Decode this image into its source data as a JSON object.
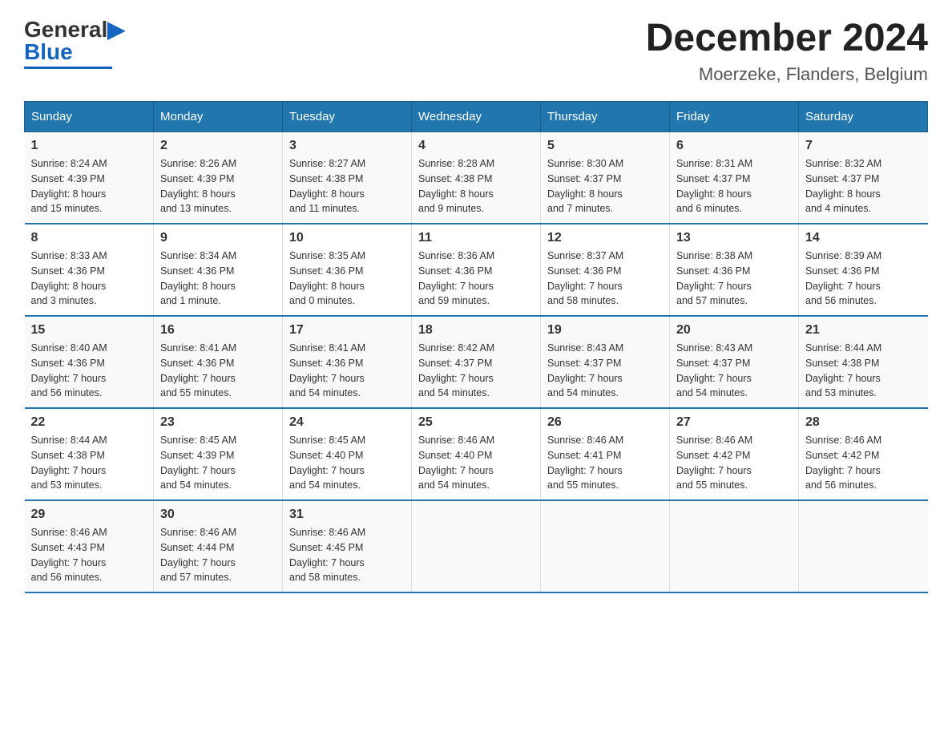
{
  "header": {
    "logo_text_black": "General",
    "logo_text_blue": "Blue",
    "title": "December 2024",
    "subtitle": "Moerzeke, Flanders, Belgium"
  },
  "calendar": {
    "days_of_week": [
      "Sunday",
      "Monday",
      "Tuesday",
      "Wednesday",
      "Thursday",
      "Friday",
      "Saturday"
    ],
    "weeks": [
      [
        {
          "day": "1",
          "info": "Sunrise: 8:24 AM\nSunset: 4:39 PM\nDaylight: 8 hours\nand 15 minutes."
        },
        {
          "day": "2",
          "info": "Sunrise: 8:26 AM\nSunset: 4:39 PM\nDaylight: 8 hours\nand 13 minutes."
        },
        {
          "day": "3",
          "info": "Sunrise: 8:27 AM\nSunset: 4:38 PM\nDaylight: 8 hours\nand 11 minutes."
        },
        {
          "day": "4",
          "info": "Sunrise: 8:28 AM\nSunset: 4:38 PM\nDaylight: 8 hours\nand 9 minutes."
        },
        {
          "day": "5",
          "info": "Sunrise: 8:30 AM\nSunset: 4:37 PM\nDaylight: 8 hours\nand 7 minutes."
        },
        {
          "day": "6",
          "info": "Sunrise: 8:31 AM\nSunset: 4:37 PM\nDaylight: 8 hours\nand 6 minutes."
        },
        {
          "day": "7",
          "info": "Sunrise: 8:32 AM\nSunset: 4:37 PM\nDaylight: 8 hours\nand 4 minutes."
        }
      ],
      [
        {
          "day": "8",
          "info": "Sunrise: 8:33 AM\nSunset: 4:36 PM\nDaylight: 8 hours\nand 3 minutes."
        },
        {
          "day": "9",
          "info": "Sunrise: 8:34 AM\nSunset: 4:36 PM\nDaylight: 8 hours\nand 1 minute."
        },
        {
          "day": "10",
          "info": "Sunrise: 8:35 AM\nSunset: 4:36 PM\nDaylight: 8 hours\nand 0 minutes."
        },
        {
          "day": "11",
          "info": "Sunrise: 8:36 AM\nSunset: 4:36 PM\nDaylight: 7 hours\nand 59 minutes."
        },
        {
          "day": "12",
          "info": "Sunrise: 8:37 AM\nSunset: 4:36 PM\nDaylight: 7 hours\nand 58 minutes."
        },
        {
          "day": "13",
          "info": "Sunrise: 8:38 AM\nSunset: 4:36 PM\nDaylight: 7 hours\nand 57 minutes."
        },
        {
          "day": "14",
          "info": "Sunrise: 8:39 AM\nSunset: 4:36 PM\nDaylight: 7 hours\nand 56 minutes."
        }
      ],
      [
        {
          "day": "15",
          "info": "Sunrise: 8:40 AM\nSunset: 4:36 PM\nDaylight: 7 hours\nand 56 minutes."
        },
        {
          "day": "16",
          "info": "Sunrise: 8:41 AM\nSunset: 4:36 PM\nDaylight: 7 hours\nand 55 minutes."
        },
        {
          "day": "17",
          "info": "Sunrise: 8:41 AM\nSunset: 4:36 PM\nDaylight: 7 hours\nand 54 minutes."
        },
        {
          "day": "18",
          "info": "Sunrise: 8:42 AM\nSunset: 4:37 PM\nDaylight: 7 hours\nand 54 minutes."
        },
        {
          "day": "19",
          "info": "Sunrise: 8:43 AM\nSunset: 4:37 PM\nDaylight: 7 hours\nand 54 minutes."
        },
        {
          "day": "20",
          "info": "Sunrise: 8:43 AM\nSunset: 4:37 PM\nDaylight: 7 hours\nand 54 minutes."
        },
        {
          "day": "21",
          "info": "Sunrise: 8:44 AM\nSunset: 4:38 PM\nDaylight: 7 hours\nand 53 minutes."
        }
      ],
      [
        {
          "day": "22",
          "info": "Sunrise: 8:44 AM\nSunset: 4:38 PM\nDaylight: 7 hours\nand 53 minutes."
        },
        {
          "day": "23",
          "info": "Sunrise: 8:45 AM\nSunset: 4:39 PM\nDaylight: 7 hours\nand 54 minutes."
        },
        {
          "day": "24",
          "info": "Sunrise: 8:45 AM\nSunset: 4:40 PM\nDaylight: 7 hours\nand 54 minutes."
        },
        {
          "day": "25",
          "info": "Sunrise: 8:46 AM\nSunset: 4:40 PM\nDaylight: 7 hours\nand 54 minutes."
        },
        {
          "day": "26",
          "info": "Sunrise: 8:46 AM\nSunset: 4:41 PM\nDaylight: 7 hours\nand 55 minutes."
        },
        {
          "day": "27",
          "info": "Sunrise: 8:46 AM\nSunset: 4:42 PM\nDaylight: 7 hours\nand 55 minutes."
        },
        {
          "day": "28",
          "info": "Sunrise: 8:46 AM\nSunset: 4:42 PM\nDaylight: 7 hours\nand 56 minutes."
        }
      ],
      [
        {
          "day": "29",
          "info": "Sunrise: 8:46 AM\nSunset: 4:43 PM\nDaylight: 7 hours\nand 56 minutes."
        },
        {
          "day": "30",
          "info": "Sunrise: 8:46 AM\nSunset: 4:44 PM\nDaylight: 7 hours\nand 57 minutes."
        },
        {
          "day": "31",
          "info": "Sunrise: 8:46 AM\nSunset: 4:45 PM\nDaylight: 7 hours\nand 58 minutes."
        },
        {
          "day": "",
          "info": ""
        },
        {
          "day": "",
          "info": ""
        },
        {
          "day": "",
          "info": ""
        },
        {
          "day": "",
          "info": ""
        }
      ]
    ]
  }
}
